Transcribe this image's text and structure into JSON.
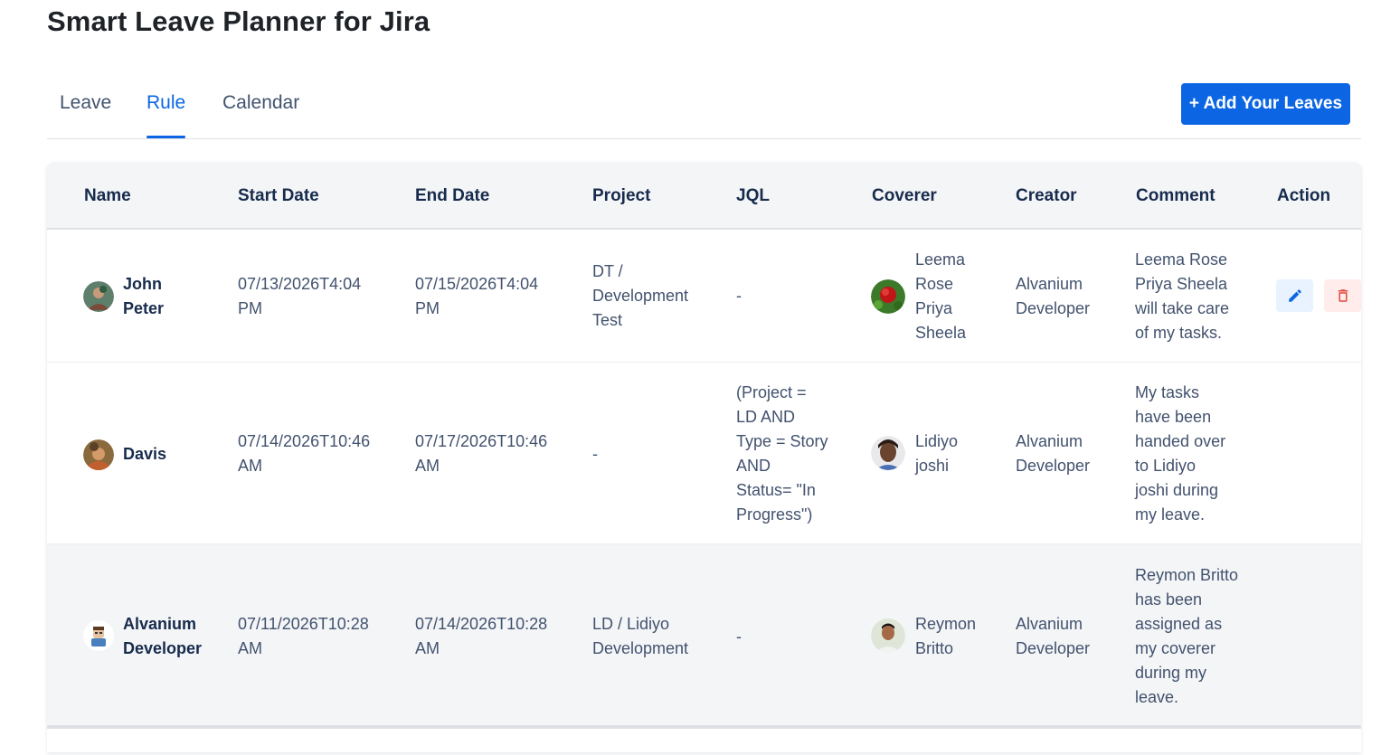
{
  "app": {
    "title": "Smart Leave Planner for Jira"
  },
  "tabs": [
    {
      "label": "Leave",
      "active": false
    },
    {
      "label": "Rule",
      "active": true
    },
    {
      "label": "Calendar",
      "active": false
    }
  ],
  "actions": {
    "add_leaves_label": "+ Add Your Leaves"
  },
  "table": {
    "headers": [
      "Name",
      "Start Date",
      "End Date",
      "Project",
      "JQL",
      "Coverer",
      "Creator",
      "Comment",
      "Action"
    ],
    "rows": [
      {
        "name": [
          "John",
          "Peter"
        ],
        "start": [
          "07/13/2026T4:04",
          "PM"
        ],
        "end": [
          "07/15/2026T4:04",
          "PM"
        ],
        "project": [
          "DT /",
          "Development",
          "Test"
        ],
        "jql": [
          "-"
        ],
        "coverer": [
          "Leema",
          "Rose",
          "Priya",
          "Sheela"
        ],
        "creator": [
          "Alvanium",
          "Developer"
        ],
        "comment": [
          "Leema Rose",
          "Priya Sheela",
          "will take care",
          "of my tasks."
        ]
      },
      {
        "name": [
          "Davis"
        ],
        "start": [
          "07/14/2026T10:46",
          "AM"
        ],
        "end": [
          "07/17/2026T10:46",
          "AM"
        ],
        "project": [
          "-"
        ],
        "jql": [
          "(Project =",
          "LD AND",
          "Type = Story",
          "AND",
          "Status= \"In",
          "Progress\")"
        ],
        "coverer": [
          "Lidiyo",
          "joshi"
        ],
        "creator": [
          "Alvanium",
          "Developer"
        ],
        "comment": [
          "My tasks",
          "have been",
          "handed over",
          "to Lidiyo",
          "joshi during",
          "my leave."
        ]
      },
      {
        "name": [
          "Alvanium",
          "Developer"
        ],
        "start": [
          "07/11/2026T10:28",
          "AM"
        ],
        "end": [
          "07/14/2026T10:28",
          "AM"
        ],
        "project": [
          "LD / Lidiyo",
          "Development"
        ],
        "jql": [
          "-"
        ],
        "coverer": [
          "Reymon",
          "Britto"
        ],
        "creator": [
          "Alvanium",
          "Developer"
        ],
        "comment": [
          "Reymon Britto",
          "has been",
          "assigned as",
          "my coverer",
          "during my",
          "leave."
        ]
      }
    ]
  },
  "colors": {
    "accent": "#0c66e4",
    "danger": "#e2483d",
    "header_bg": "#f4f5f7"
  },
  "icons": {
    "edit": "pencil-icon",
    "delete": "trash-icon"
  }
}
